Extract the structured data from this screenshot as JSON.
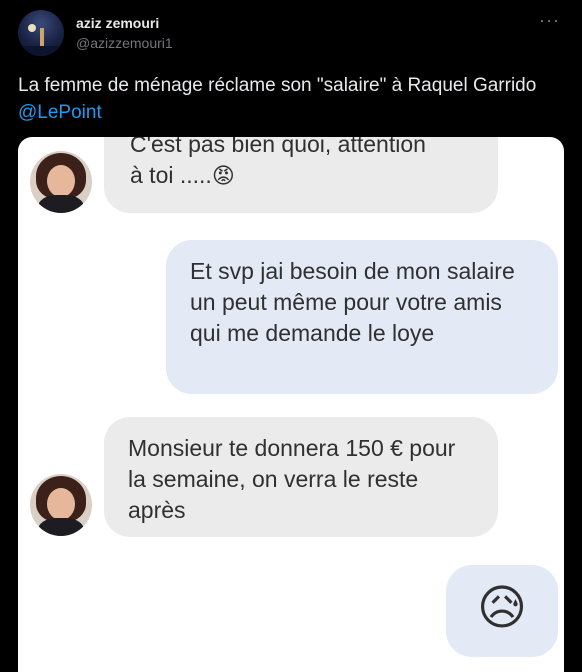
{
  "author": {
    "name": "aziz zemouri",
    "handle": "@azizzemouri1",
    "more_glyph": "···"
  },
  "tweet": {
    "text_before": "La femme de ménage réclame son \"salaire\" à Raquel Garrido ",
    "mention": "@LePoint"
  },
  "chat": {
    "msg1_line1": "C'est pas bien quoi, attention",
    "msg1_line2": "à toi .....",
    "msg1_emoji": "😡",
    "msg2": "Et svp jai besoin de mon salaire un peut même pour votre amis qui me demande le loye",
    "msg3": "Monsieur te donnera 150 € pour la semaine, on verra le reste après",
    "msg4_emoji": "😥"
  }
}
